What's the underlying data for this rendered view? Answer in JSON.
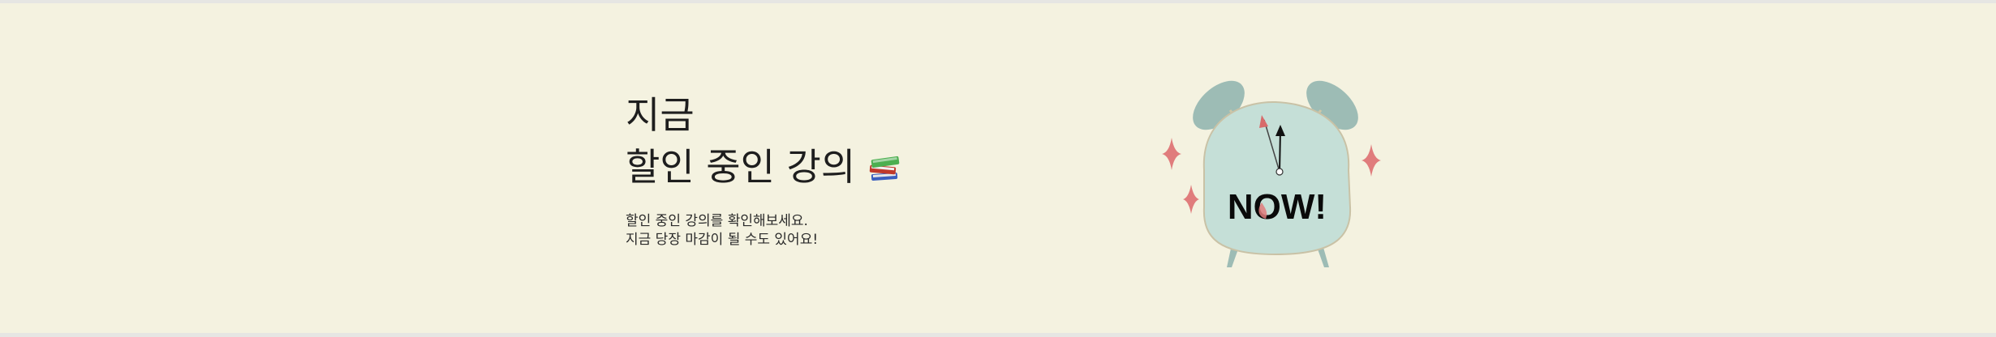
{
  "banner": {
    "title_line1": "지금",
    "title_line2": "할인 중인 강의",
    "title_icon": "books-icon",
    "description_line1": "할인 중인 강의를 확인해보세요.",
    "description_line2": "지금 당장 마감이 될 수도 있어요!",
    "illustration": {
      "icon": "alarm-clock-icon",
      "text": "NOW!",
      "colors": {
        "clock_face": "#c5dfd7",
        "bells": "#9dbcb5",
        "sparkle": "#e07c7c",
        "minute_hand": "#d86a6a",
        "hour_hand": "#111111"
      }
    },
    "background": "#f4f2e0"
  }
}
